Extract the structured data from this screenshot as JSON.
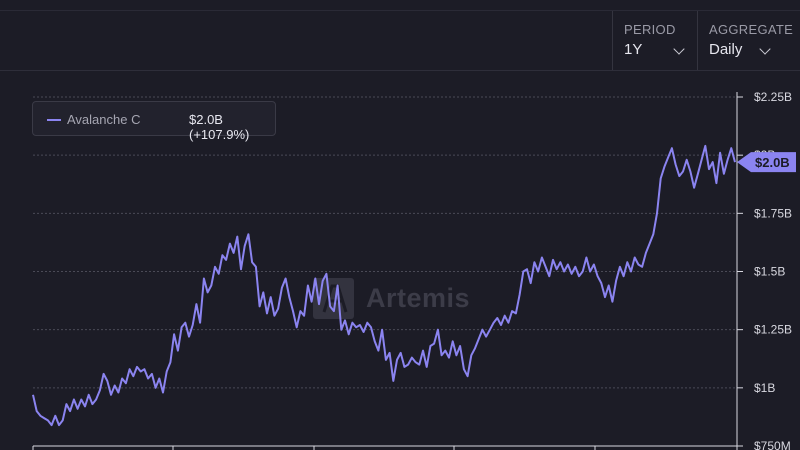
{
  "controls": {
    "period": {
      "label": "PERIOD",
      "value": "1Y",
      "icon": "chevron-down-icon"
    },
    "aggregate": {
      "label": "AGGREGATE",
      "value": "Daily",
      "icon": "chevron-down-icon"
    }
  },
  "legend": {
    "name": "Avalanche C",
    "value": "$2.0B (+107.9%)"
  },
  "watermark": {
    "text": "Artemis",
    "icon": "artemis-logo-icon"
  },
  "last_value_label": "$2.0B",
  "colors": {
    "background": "#1c1c26",
    "line": "#8b84f0",
    "grid": "#4a4a56"
  },
  "chart_data": {
    "type": "line",
    "title": "",
    "xlabel": "",
    "ylabel": "",
    "ylim": [
      0.75,
      2.25
    ],
    "yticks": [
      {
        "value": 2.25,
        "label": "$2.25B"
      },
      {
        "value": 2.0,
        "label": "$2B"
      },
      {
        "value": 1.75,
        "label": "$1.75B"
      },
      {
        "value": 1.5,
        "label": "$1.5B"
      },
      {
        "value": 1.25,
        "label": "$1.25B"
      },
      {
        "value": 1.0,
        "label": "$1B"
      },
      {
        "value": 0.75,
        "label": "$750M"
      }
    ],
    "grid": true,
    "legend_position": "top-left",
    "series": [
      {
        "name": "Avalanche C",
        "unit": "USD billions",
        "x_range_days": [
          0,
          365
        ],
        "values": [
          0.97,
          0.9,
          0.88,
          0.87,
          0.86,
          0.84,
          0.88,
          0.84,
          0.86,
          0.93,
          0.9,
          0.95,
          0.91,
          0.95,
          0.92,
          0.97,
          0.93,
          0.95,
          0.99,
          1.06,
          1.03,
          0.97,
          1.01,
          0.98,
          1.04,
          1.02,
          1.08,
          1.05,
          1.09,
          1.07,
          1.08,
          1.04,
          1.06,
          1.0,
          1.04,
          0.98,
          1.07,
          1.11,
          1.23,
          1.16,
          1.26,
          1.28,
          1.22,
          1.27,
          1.36,
          1.28,
          1.47,
          1.41,
          1.44,
          1.52,
          1.49,
          1.57,
          1.55,
          1.62,
          1.58,
          1.65,
          1.51,
          1.61,
          1.66,
          1.54,
          1.52,
          1.35,
          1.41,
          1.32,
          1.39,
          1.31,
          1.34,
          1.43,
          1.47,
          1.39,
          1.33,
          1.26,
          1.33,
          1.31,
          1.44,
          1.37,
          1.47,
          1.36,
          1.46,
          1.49,
          1.35,
          1.33,
          1.44,
          1.25,
          1.29,
          1.23,
          1.28,
          1.26,
          1.27,
          1.24,
          1.28,
          1.26,
          1.2,
          1.16,
          1.25,
          1.12,
          1.15,
          1.03,
          1.12,
          1.15,
          1.09,
          1.1,
          1.13,
          1.11,
          1.1,
          1.16,
          1.09,
          1.18,
          1.19,
          1.25,
          1.14,
          1.16,
          1.13,
          1.2,
          1.14,
          1.18,
          1.08,
          1.05,
          1.14,
          1.17,
          1.21,
          1.25,
          1.22,
          1.25,
          1.28,
          1.3,
          1.27,
          1.31,
          1.28,
          1.33,
          1.32,
          1.4,
          1.5,
          1.51,
          1.45,
          1.54,
          1.5,
          1.56,
          1.52,
          1.48,
          1.55,
          1.51,
          1.54,
          1.5,
          1.53,
          1.49,
          1.52,
          1.48,
          1.5,
          1.56,
          1.5,
          1.53,
          1.48,
          1.45,
          1.39,
          1.44,
          1.37,
          1.46,
          1.52,
          1.48,
          1.54,
          1.5,
          1.56,
          1.53,
          1.52,
          1.58,
          1.62,
          1.66,
          1.75,
          1.9,
          1.95,
          1.99,
          2.03,
          1.96,
          1.91,
          1.93,
          1.98,
          1.93,
          1.86,
          1.92,
          1.98,
          2.04,
          1.94,
          1.97,
          1.88,
          2.01,
          1.92,
          1.98,
          2.03,
          1.97
        ]
      }
    ]
  }
}
